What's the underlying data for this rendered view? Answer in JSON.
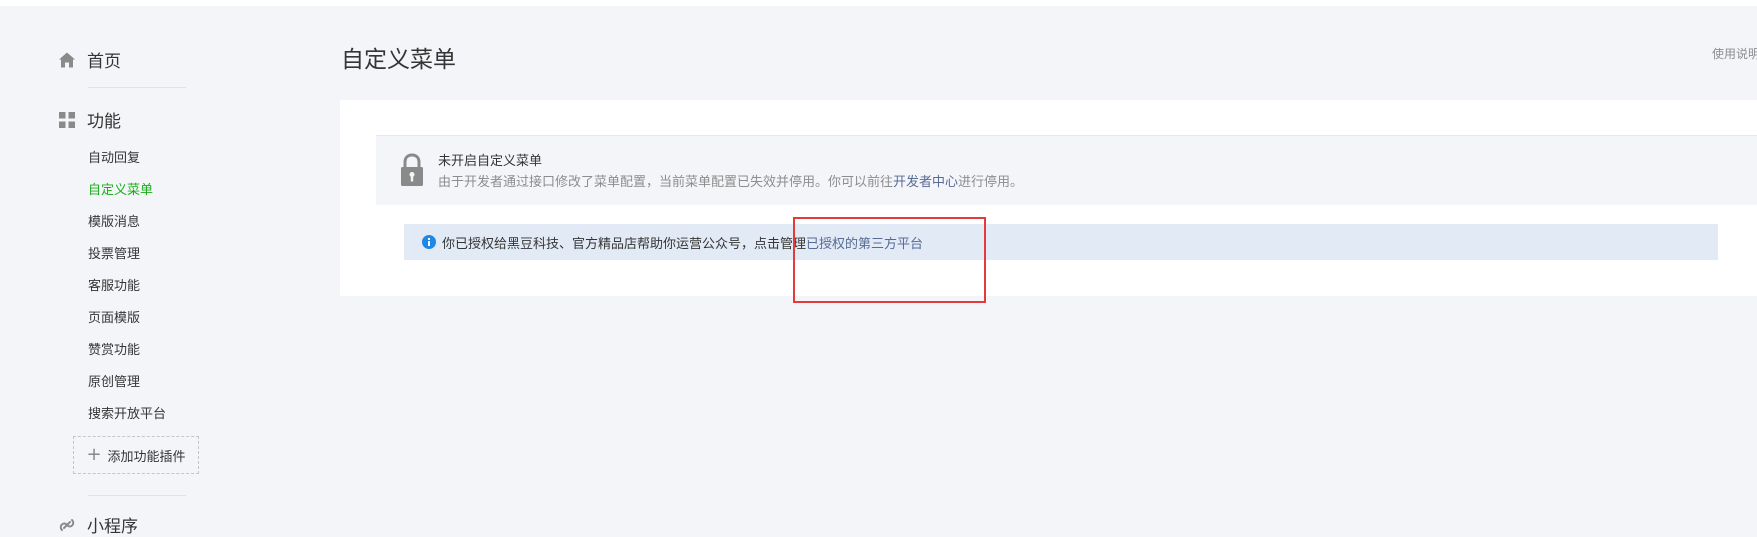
{
  "sidebar": {
    "home_label": "首页",
    "function_label": "功能",
    "items": [
      {
        "label": "自动回复"
      },
      {
        "label": "自定义菜单",
        "active": true
      },
      {
        "label": "模版消息"
      },
      {
        "label": "投票管理"
      },
      {
        "label": "客服功能"
      },
      {
        "label": "页面模版"
      },
      {
        "label": "赞赏功能"
      },
      {
        "label": "原创管理"
      },
      {
        "label": "搜索开放平台"
      }
    ],
    "add_plugin_label": "添加功能插件",
    "mini_program_label": "小程序",
    "icons": {
      "home": "home-icon",
      "function": "grid-icon",
      "add": "plus-icon",
      "mini_program": "link-icon"
    }
  },
  "header": {
    "page_title": "自定义菜单",
    "help_link": "使用说明"
  },
  "notice": {
    "title": "未开启自定义菜单",
    "desc_before": "由于开发者通过接口修改了菜单配置，当前菜单配置已失效并停用。你可以前往",
    "desc_link": "开发者中心",
    "desc_after": "进行停用。",
    "icon": "lock-icon"
  },
  "auth_notice": {
    "text_before": "你已授权给黑豆科技、官方精品店帮助你运营公众号，点击管理",
    "link": "已授权的第三方平台",
    "icon": "info-icon"
  },
  "colors": {
    "accent": "#1aad19",
    "link": "#576b95",
    "highlight": "#e33a3a",
    "info_bg": "#e2eaf5",
    "info_icon": "#1e88e5"
  }
}
